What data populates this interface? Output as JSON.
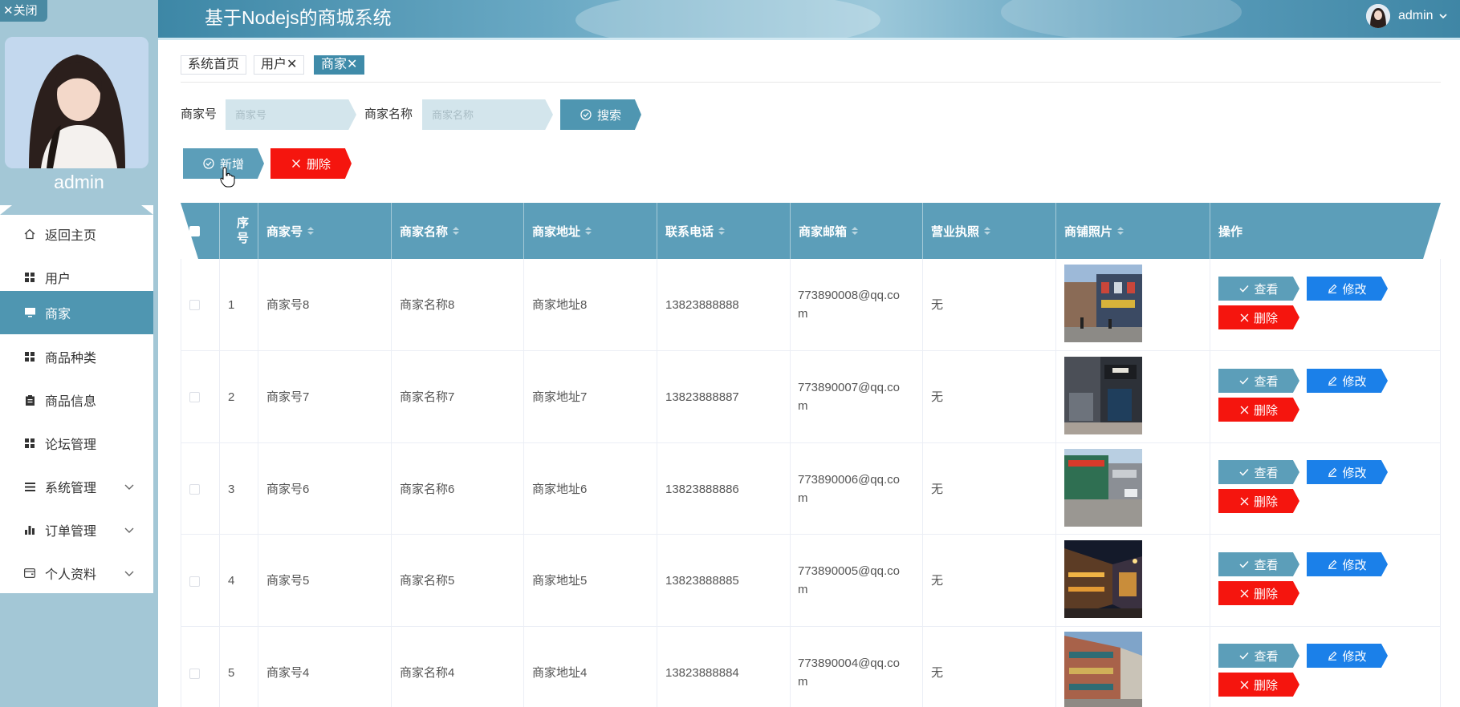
{
  "app": {
    "title": "基于Nodejs的商城系统"
  },
  "header": {
    "username": "admin"
  },
  "sidebar": {
    "close_label": "✕关闭",
    "username": "admin",
    "items": [
      {
        "label": "返回主页",
        "icon": "home-icon"
      },
      {
        "label": "用户",
        "icon": "grid-icon"
      },
      {
        "label": "商家",
        "icon": "monitor-icon"
      },
      {
        "label": "商品种类",
        "icon": "grid-icon"
      },
      {
        "label": "商品信息",
        "icon": "clipboard-icon"
      },
      {
        "label": "论坛管理",
        "icon": "grid-icon"
      },
      {
        "label": "系统管理",
        "icon": "list-icon"
      },
      {
        "label": "订单管理",
        "icon": "bar-chart-icon"
      },
      {
        "label": "个人资料",
        "icon": "wallet-icon"
      }
    ],
    "active_index": 2
  },
  "tabs": [
    "系统首页",
    "用户✕",
    "商家✕"
  ],
  "search": {
    "merchant_no_label": "商家号",
    "merchant_no_placeholder": "商家号",
    "merchant_name_label": "商家名称",
    "merchant_name_placeholder": "商家名称",
    "button_label": "搜索"
  },
  "actions": {
    "add_label": "新增",
    "delete_label": "删除"
  },
  "table": {
    "headers": [
      "序号",
      "商家号",
      "商家名称",
      "商家地址",
      "联系电话",
      "商家邮箱",
      "营业执照",
      "商铺照片",
      "操作"
    ],
    "index_header_chars": [
      "序",
      "号"
    ],
    "rows": [
      {
        "index": "1",
        "no": "商家号8",
        "name": "商家名称8",
        "address": "商家地址8",
        "phone": "13823888888",
        "email_l1": "773890008@qq.co",
        "email_l2": "m",
        "license": "无"
      },
      {
        "index": "2",
        "no": "商家号7",
        "name": "商家名称7",
        "address": "商家地址7",
        "phone": "13823888887",
        "email_l1": "773890007@qq.co",
        "email_l2": "m",
        "license": "无"
      },
      {
        "index": "3",
        "no": "商家号6",
        "name": "商家名称6",
        "address": "商家地址6",
        "phone": "13823888886",
        "email_l1": "773890006@qq.co",
        "email_l2": "m",
        "license": "无"
      },
      {
        "index": "4",
        "no": "商家号5",
        "name": "商家名称5",
        "address": "商家地址5",
        "phone": "13823888885",
        "email_l1": "773890005@qq.co",
        "email_l2": "m",
        "license": "无"
      },
      {
        "index": "5",
        "no": "商家号4",
        "name": "商家名称4",
        "address": "商家地址4",
        "phone": "13823888884",
        "email_l1": "773890004@qq.co",
        "email_l2": "m",
        "license": "无"
      }
    ],
    "row_actions": {
      "view": "查看",
      "edit": "修改",
      "delete": "删除"
    }
  },
  "colors": {
    "accent": "#4f96b1",
    "table_header": "#5c9eb9",
    "edit_button": "#1b80e9",
    "delete_button": "#f5150e",
    "sidebar_bg": "#a3c7d6"
  }
}
